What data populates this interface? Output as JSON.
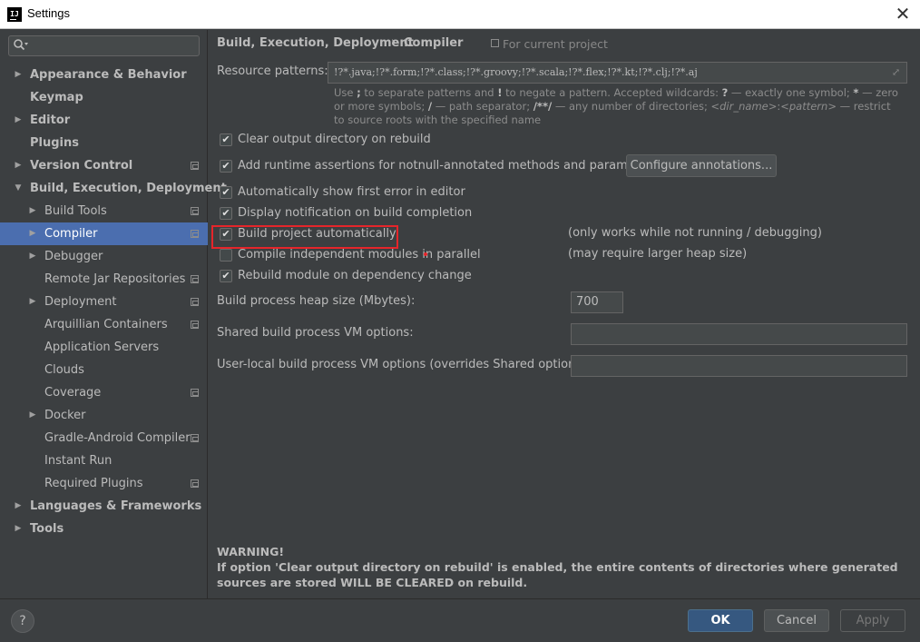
{
  "window": {
    "title": "Settings",
    "app_icon_text": "IJ",
    "close_glyph": "✕"
  },
  "search": {
    "placeholder": ""
  },
  "tree": [
    {
      "label": "Appearance & Behavior",
      "level": 0,
      "expandable": true,
      "expanded": false,
      "bold": true,
      "project": false,
      "selected": false
    },
    {
      "label": "Keymap",
      "level": 0,
      "expandable": false,
      "bold": true,
      "project": false,
      "selected": false
    },
    {
      "label": "Editor",
      "level": 0,
      "expandable": true,
      "expanded": false,
      "bold": true,
      "project": false,
      "selected": false
    },
    {
      "label": "Plugins",
      "level": 0,
      "expandable": false,
      "bold": true,
      "project": false,
      "selected": false
    },
    {
      "label": "Version Control",
      "level": 0,
      "expandable": true,
      "expanded": false,
      "bold": true,
      "project": true,
      "selected": false
    },
    {
      "label": "Build, Execution, Deployment",
      "level": 0,
      "expandable": true,
      "expanded": true,
      "bold": true,
      "project": false,
      "selected": false
    },
    {
      "label": "Build Tools",
      "level": 1,
      "expandable": true,
      "expanded": false,
      "bold": false,
      "project": true,
      "selected": false
    },
    {
      "label": "Compiler",
      "level": 1,
      "expandable": true,
      "expanded": false,
      "bold": false,
      "project": true,
      "selected": true
    },
    {
      "label": "Debugger",
      "level": 1,
      "expandable": true,
      "expanded": false,
      "bold": false,
      "project": false,
      "selected": false
    },
    {
      "label": "Remote Jar Repositories",
      "level": 1,
      "expandable": false,
      "bold": false,
      "project": true,
      "selected": false
    },
    {
      "label": "Deployment",
      "level": 1,
      "expandable": true,
      "expanded": false,
      "bold": false,
      "project": true,
      "selected": false
    },
    {
      "label": "Arquillian Containers",
      "level": 1,
      "expandable": false,
      "bold": false,
      "project": true,
      "selected": false
    },
    {
      "label": "Application Servers",
      "level": 1,
      "expandable": false,
      "bold": false,
      "project": false,
      "selected": false
    },
    {
      "label": "Clouds",
      "level": 1,
      "expandable": false,
      "bold": false,
      "project": false,
      "selected": false
    },
    {
      "label": "Coverage",
      "level": 1,
      "expandable": false,
      "bold": false,
      "project": true,
      "selected": false
    },
    {
      "label": "Docker",
      "level": 1,
      "expandable": true,
      "expanded": false,
      "bold": false,
      "project": false,
      "selected": false
    },
    {
      "label": "Gradle-Android Compiler",
      "level": 1,
      "expandable": false,
      "bold": false,
      "project": true,
      "selected": false
    },
    {
      "label": "Instant Run",
      "level": 1,
      "expandable": false,
      "bold": false,
      "project": false,
      "selected": false
    },
    {
      "label": "Required Plugins",
      "level": 1,
      "expandable": false,
      "bold": false,
      "project": true,
      "selected": false
    },
    {
      "label": "Languages & Frameworks",
      "level": 0,
      "expandable": true,
      "expanded": false,
      "bold": true,
      "project": false,
      "selected": false
    },
    {
      "label": "Tools",
      "level": 0,
      "expandable": true,
      "expanded": false,
      "bold": true,
      "project": false,
      "selected": false
    }
  ],
  "breadcrumb": {
    "parent": "Build, Execution, Deployment",
    "separator": "›",
    "current": "Compiler",
    "scope": "For current project"
  },
  "resource_patterns": {
    "label": "Resource patterns:",
    "value": "!?*.java;!?*.form;!?*.class;!?*.groovy;!?*.scala;!?*.flex;!?*.kt;!?*.clj;!?*.aj",
    "hint": {
      "p1": "Use ",
      "b1": ";",
      "p2": " to separate patterns and ",
      "b2": "!",
      "p3": " to negate a pattern. Accepted wildcards: ",
      "b3": "?",
      "p4": " — exactly one symbol; ",
      "b4": "*",
      "p5": " — zero or more symbols; ",
      "b5": "/",
      "p6": " — path separator; ",
      "b6": "/**/",
      "p7": " — any number of directories; ",
      "i1": "<dir_name>",
      "p8": ":",
      "i2": "<pattern>",
      "p9": " — restrict to source roots with the specified name"
    }
  },
  "options": {
    "clear_output": {
      "label": "Clear output directory on rebuild",
      "checked": true
    },
    "runtime_assertions": {
      "label": "Add runtime assertions for notnull-annotated methods and parameters",
      "checked": true
    },
    "configure_annotations": "Configure annotations...",
    "show_first_error": {
      "label": "Automatically show first error in editor",
      "checked": true
    },
    "display_notification": {
      "label": "Display notification on build completion",
      "checked": true
    },
    "build_auto": {
      "label": "Build project automatically",
      "checked": true,
      "note": "(only works while not running / debugging)"
    },
    "compile_parallel": {
      "label": "Compile independent modules in parallel",
      "checked": false,
      "note": "(may require larger heap size)"
    },
    "rebuild_dependency": {
      "label": "Rebuild module on dependency change",
      "checked": true
    }
  },
  "fields": {
    "heap_label": "Build process heap size (Mbytes):",
    "heap_value": "700",
    "shared_vm_label": "Shared build process VM options:",
    "shared_vm_value": "",
    "user_vm_label": "User-local build process VM options (overrides Shared options):",
    "user_vm_value": ""
  },
  "warning": {
    "title": "WARNING!",
    "text": "If option 'Clear output directory on rebuild' is enabled, the entire contents of directories where generated sources are stored WILL BE CLEARED on rebuild."
  },
  "footer": {
    "help": "?",
    "ok": "OK",
    "cancel": "Cancel",
    "apply": "Apply"
  },
  "colors": {
    "background": "#3c3f41",
    "selection": "#4b6eaf",
    "highlight": "#e5252a",
    "ok_button": "#365880"
  }
}
